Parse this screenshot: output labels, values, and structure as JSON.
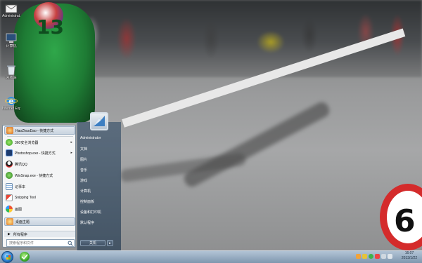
{
  "desktop": {
    "icons": [
      {
        "label": "Administrat...",
        "icon": "mail-icon"
      },
      {
        "label": "计算机",
        "icon": "computer-icon"
      },
      {
        "label": "回收站",
        "icon": "recycle-bin-icon"
      },
      {
        "label": "Internet Explorer",
        "icon": "ie-icon"
      }
    ],
    "wallpaper": {
      "rider_number": "13",
      "sign_number": "6"
    }
  },
  "start_menu": {
    "programs": [
      {
        "label": "HaoZhuoDao - 快捷方式",
        "icon": "user-app-icon",
        "arrow": ""
      },
      {
        "label": "360安全浏览器",
        "icon": "browser-360-icon",
        "arrow": "▸"
      },
      {
        "label": "Photoshop.exe - 快捷方式",
        "icon": "photoshop-icon",
        "arrow": "▸"
      },
      {
        "label": "腾讯QQ",
        "icon": "qq-icon",
        "arrow": ""
      },
      {
        "label": "WinSnap.exe - 快捷方式",
        "icon": "winsnap-icon",
        "arrow": ""
      },
      {
        "label": "记事本",
        "icon": "notepad-icon",
        "arrow": ""
      },
      {
        "label": "Snipping Tool",
        "icon": "snipping-tool-icon",
        "arrow": ""
      },
      {
        "label": "画图",
        "icon": "paint-icon",
        "arrow": ""
      },
      {
        "label": "桌面主题",
        "icon": "desktop-theme-icon",
        "arrow": ""
      }
    ],
    "all_programs": "所有程序",
    "all_programs_arrow": "▶",
    "search_placeholder": "搜索程序和文件",
    "right_items": [
      "Administrator",
      "文档",
      "图片",
      "音乐",
      "游戏",
      "计算机",
      "控制面板",
      "设备和打印机",
      "默认程序"
    ],
    "shutdown_label": "关机",
    "shutdown_arrow": "▸"
  },
  "taskbar": {
    "clock_time": "16:07",
    "clock_date": "2013/1/22"
  },
  "colors": {
    "start_menu_right": "#4e6276",
    "taskbar": "#8aa1b8",
    "highlight": "#c9d4df"
  }
}
